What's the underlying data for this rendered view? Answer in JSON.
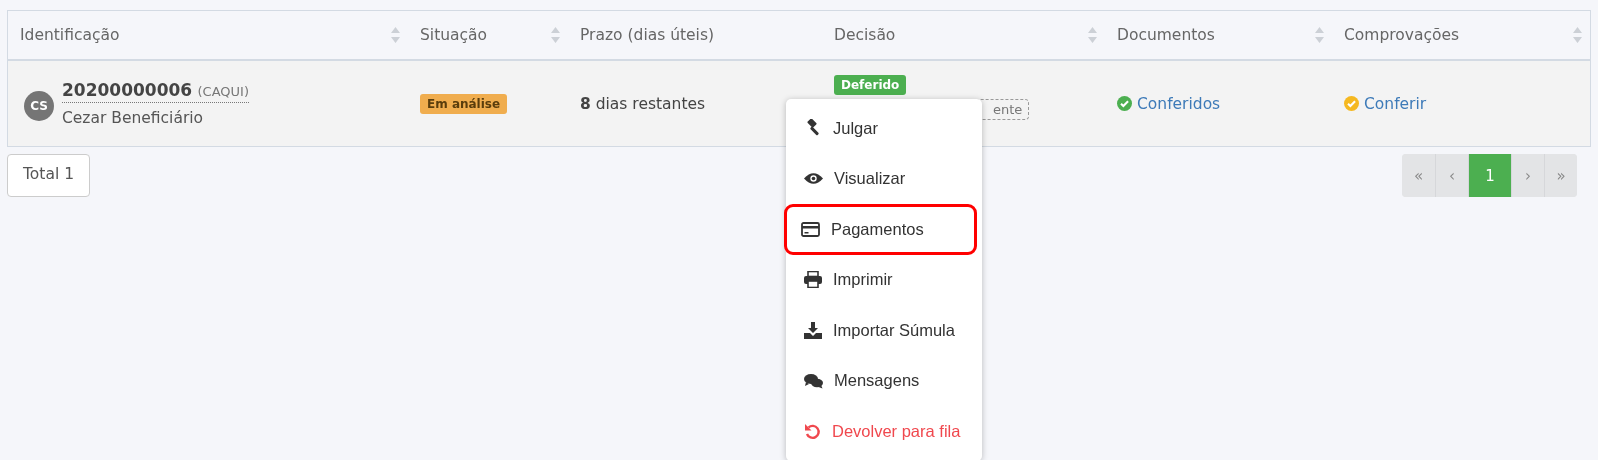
{
  "table": {
    "columns": [
      {
        "label": "Identificação",
        "sortable": true
      },
      {
        "label": "Situação",
        "sortable": true
      },
      {
        "label": "Prazo (dias úteis)",
        "sortable": false
      },
      {
        "label": "Decisão",
        "sortable": true
      },
      {
        "label": "Documentos",
        "sortable": true
      },
      {
        "label": "Comprovações",
        "sortable": true
      }
    ],
    "rows": [
      {
        "avatar": "CS",
        "id": "20200000006",
        "code": "(CAQUI)",
        "name": "Cezar Beneficiário",
        "status": "Em análise",
        "deadline": "**8** dias restantes",
        "decision": "Deferido",
        "decision_note": "ente",
        "documents": {
          "label": "Conferidos",
          "color": "#4caf50"
        },
        "proofs": {
          "label": "Conferir",
          "color": "#f5b820"
        }
      }
    ]
  },
  "total": "Total 1",
  "pagination": [
    {
      "label": "«",
      "selected": false
    },
    {
      "label": "‹",
      "selected": false
    },
    {
      "label": "1",
      "selected": true
    },
    {
      "label": "›",
      "selected": false
    },
    {
      "label": "»",
      "selected": false
    }
  ],
  "menu": [
    {
      "kind": "gavel",
      "label": "Julgar",
      "highlighted": false
    },
    {
      "kind": "eye",
      "label": "Visualizar",
      "highlighted": false
    },
    {
      "kind": "card",
      "label": "Pagamentos",
      "highlighted": true
    },
    {
      "kind": "print",
      "label": "Imprimir",
      "highlighted": false
    },
    {
      "kind": "download",
      "label": "Importar Súmula",
      "highlighted": false
    },
    {
      "kind": "comments",
      "label": "Mensagens",
      "highlighted": false
    },
    {
      "kind": "undo",
      "label": "Devolver para fila",
      "highlighted": false,
      "danger": true
    }
  ]
}
